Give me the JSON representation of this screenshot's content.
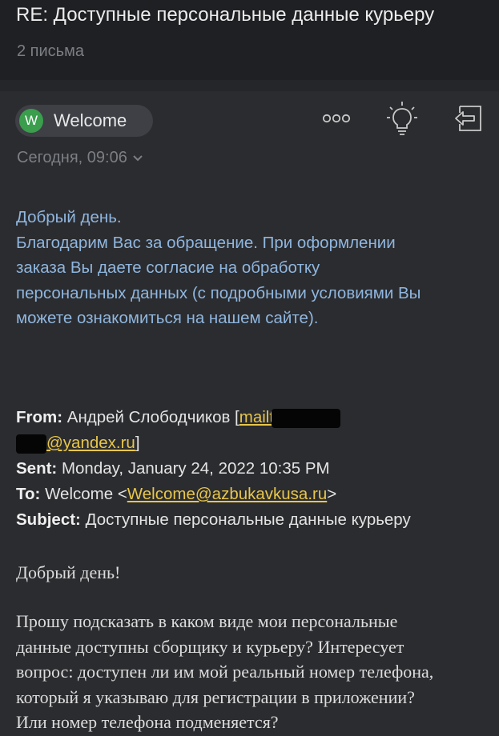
{
  "header": {
    "subject": "RE: Доступные персональные данные курьеру",
    "message_count": "2 письма"
  },
  "sender": {
    "avatar_letter": "W",
    "name": "Welcome",
    "date": "Сегодня, 09:06",
    "avatar_color": "#3a9e4d"
  },
  "actions": [
    {
      "icon": "more-icon"
    },
    {
      "icon": "lightbulb-icon"
    },
    {
      "icon": "reply-icon"
    }
  ],
  "reply": {
    "lines": [
      "Добрый день.",
      "Благодарим Вас за обращение. При оформлении",
      "заказа Вы даете согласие на обработку",
      "персональных данных (с подробными условиями Вы",
      "можете ознакомиться на нашем сайте)."
    ]
  },
  "quoted": {
    "from_label": "From:",
    "from_name": "Андрей Слободчиков [",
    "from_link_start": "mailto",
    "from_link_end": "@yandex.ru",
    "from_close": "]",
    "sent_label": "Sent:",
    "sent_value": "Monday, January 24, 2022 10:35 PM",
    "to_label": "To:",
    "to_name": "Welcome <",
    "to_email": "Welcome@azbukavkusa.ru",
    "to_close": ">",
    "subject_label": "Subject:",
    "subject_value": "Доступные персональные данные курьеру",
    "greeting": "Добрый день!",
    "body_lines": [
      "Прошу подсказать в каком виде мои персональные",
      "данные доступны сборщику и курьеру? Интересует",
      "вопрос: доступен ли им мой реальный номер телефона,",
      "который я указываю для регистрации в приложении?",
      "Или номер телефона подменяется?"
    ]
  },
  "colors": {
    "background": "#2b2c2f",
    "header_bg": "#1f2023",
    "reply_text": "#8fb6df",
    "link": "#e8c64a"
  }
}
